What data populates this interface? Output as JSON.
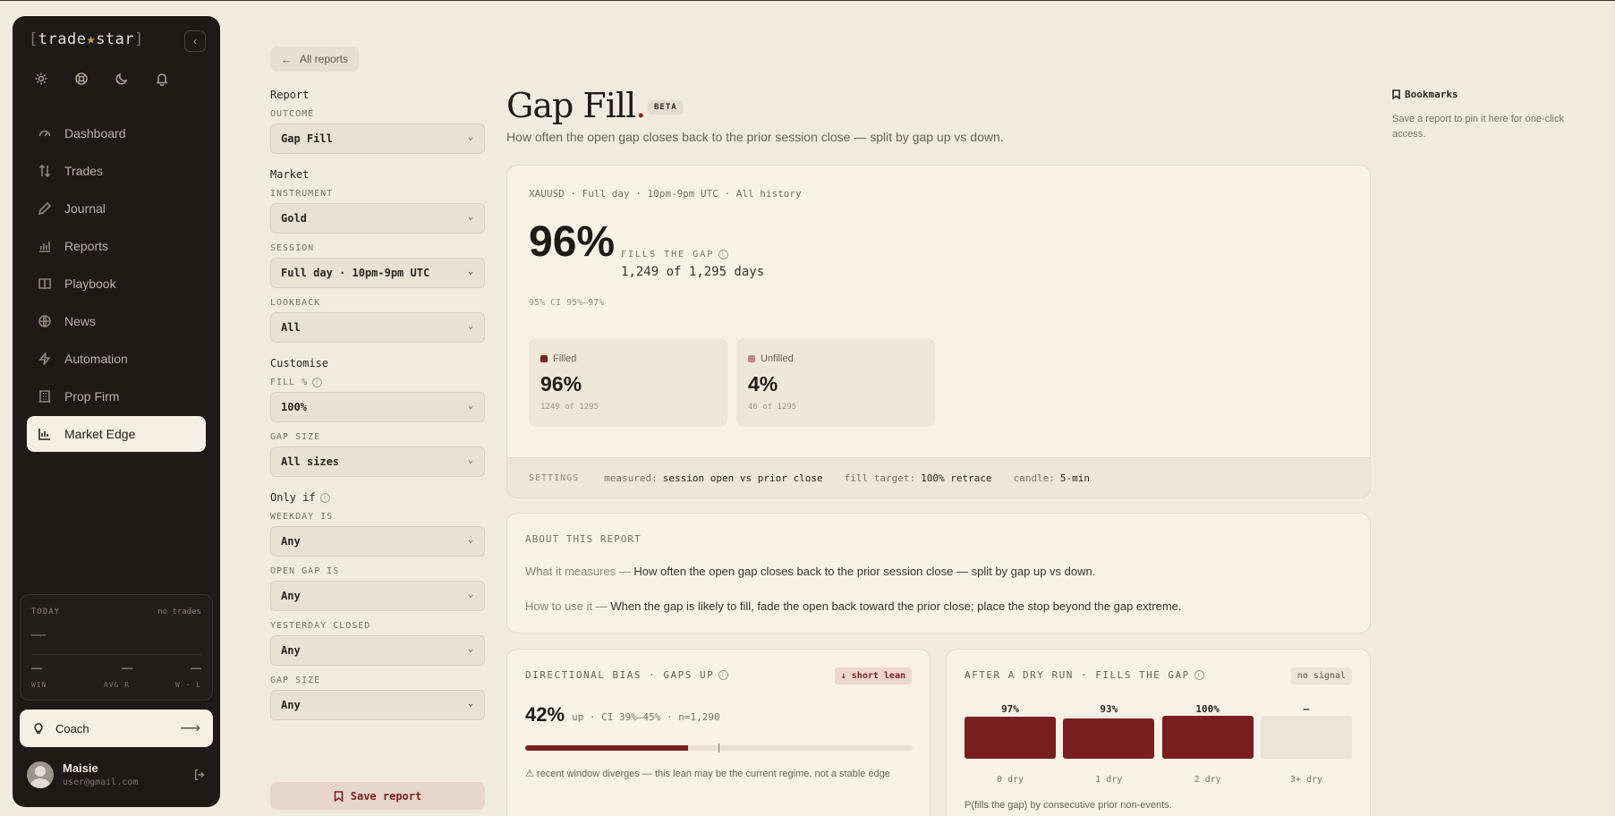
{
  "brand": {
    "bracket_open": "[",
    "name_a": "trade",
    "star": "★",
    "name_b": "star",
    "bracket_close": "]"
  },
  "sidebar": {
    "collapse_icon": "chevron-left-icon",
    "top_icons": [
      "gear-icon",
      "lifebuoy-icon",
      "moon-icon",
      "bell-icon"
    ],
    "items": [
      {
        "label": "Dashboard",
        "icon": "gauge-icon"
      },
      {
        "label": "Trades",
        "icon": "arrows-updown-icon"
      },
      {
        "label": "Journal",
        "icon": "pen-icon"
      },
      {
        "label": "Reports",
        "icon": "bar-chart-icon"
      },
      {
        "label": "Playbook",
        "icon": "book-icon"
      },
      {
        "label": "News",
        "icon": "globe-icon"
      },
      {
        "label": "Automation",
        "icon": "bolt-icon"
      },
      {
        "label": "Prop Firm",
        "icon": "building-icon"
      },
      {
        "label": "Market Edge",
        "icon": "chart-edge-icon",
        "active": true
      }
    ],
    "today": {
      "label": "TODAY",
      "status": "no trades",
      "pnl": "—",
      "win": "—",
      "avg_r": "—",
      "wl": "—",
      "win_label": "WIN",
      "avg_r_label": "AVG R",
      "wl_label": "W · L"
    },
    "coach": {
      "label": "Coach",
      "arrow": "⟶"
    },
    "user": {
      "name": "Maisie",
      "email": "user@gmail.com"
    }
  },
  "back_label": "All reports",
  "filters": {
    "report_section": "Report",
    "outcome_label": "OUTCOME",
    "outcome_value": "Gap Fill",
    "market_section": "Market",
    "instrument_label": "INSTRUMENT",
    "instrument_value": "Gold",
    "session_label": "SESSION",
    "session_value": "Full day · 10pm-9pm UTC",
    "lookback_label": "LOOKBACK",
    "lookback_value": "All",
    "customise_section": "Customise",
    "fill_label": "FILL %",
    "fill_value": "100%",
    "gapsize_label": "GAP SIZE",
    "gapsize_value": "All sizes",
    "onlyif_section": "Only if",
    "weekday_label": "WEEKDAY IS",
    "weekday_value": "Any",
    "opengap_label": "OPEN GAP IS",
    "opengap_value": "Any",
    "yesterday_label": "YESTERDAY CLOSED",
    "yesterday_value": "Any",
    "gapsize2_label": "GAP SIZE",
    "gapsize2_value": "Any",
    "save_label": "Save report"
  },
  "report": {
    "title": "Gap Fill",
    "title_dot": ".",
    "badge": "BETA",
    "subtitle": "How often the open gap closes back to the prior session close — split by gap up vs down.",
    "meta": "XAUUSD · Full day · 10pm-9pm UTC · All history",
    "headline": "96%",
    "headline_label": "FILLS THE GAP",
    "headline_count": "1,249 of 1,295 days",
    "ci": "95% CI 95%–97%",
    "filled": {
      "label": "Filled",
      "value": "96%",
      "sub": "1249 of 1295",
      "color": "#7a1f1f"
    },
    "unfilled": {
      "label": "Unfilled",
      "value": "4%",
      "sub": "46 of 1295",
      "color": "#b98a88"
    },
    "settings": {
      "label": "SETTINGS",
      "measured_k": "measured:",
      "measured_v": "session open vs prior close",
      "target_k": "fill target:",
      "target_v": "100% retrace",
      "candle_k": "candle:",
      "candle_v": "5-min"
    }
  },
  "about": {
    "heading": "ABOUT THIS REPORT",
    "what_k": "What it measures —",
    "what_v": "How often the open gap closes back to the prior session close — split by gap up vs down.",
    "how_k": "How to use it —",
    "how_v": "When the gap is likely to fill, fade the open back toward the prior close; place the stop beyond the gap extreme."
  },
  "directional": {
    "heading": "DIRECTIONAL BIAS · GAPS UP",
    "pill": "↓ short lean",
    "pct": "42%",
    "desc": "up · CI 39%–45% · n=1,290",
    "value": 0.42,
    "warn": "⚠ recent window diverges — this lean may be the current regime, not a stable edge"
  },
  "dryrun": {
    "heading": "AFTER A DRY RUN · FILLS THE GAP",
    "pill": "no signal",
    "bars": [
      {
        "label": "97%",
        "cat": "0 dry",
        "value": 97
      },
      {
        "label": "93%",
        "cat": "1 dry",
        "value": 93
      },
      {
        "label": "100%",
        "cat": "2 dry",
        "value": 100
      },
      {
        "label": "–",
        "cat": "3+ dry",
        "value": null
      }
    ],
    "footnote": "P(fills the gap) by consecutive prior non-events."
  },
  "bookmarks": {
    "title": "Bookmarks",
    "text": "Save a report to pin it here for one-click access."
  },
  "colors": {
    "accent": "#7a1f1f",
    "sidebar_bg": "#1e1a16",
    "page_bg": "#f1ebdf"
  }
}
